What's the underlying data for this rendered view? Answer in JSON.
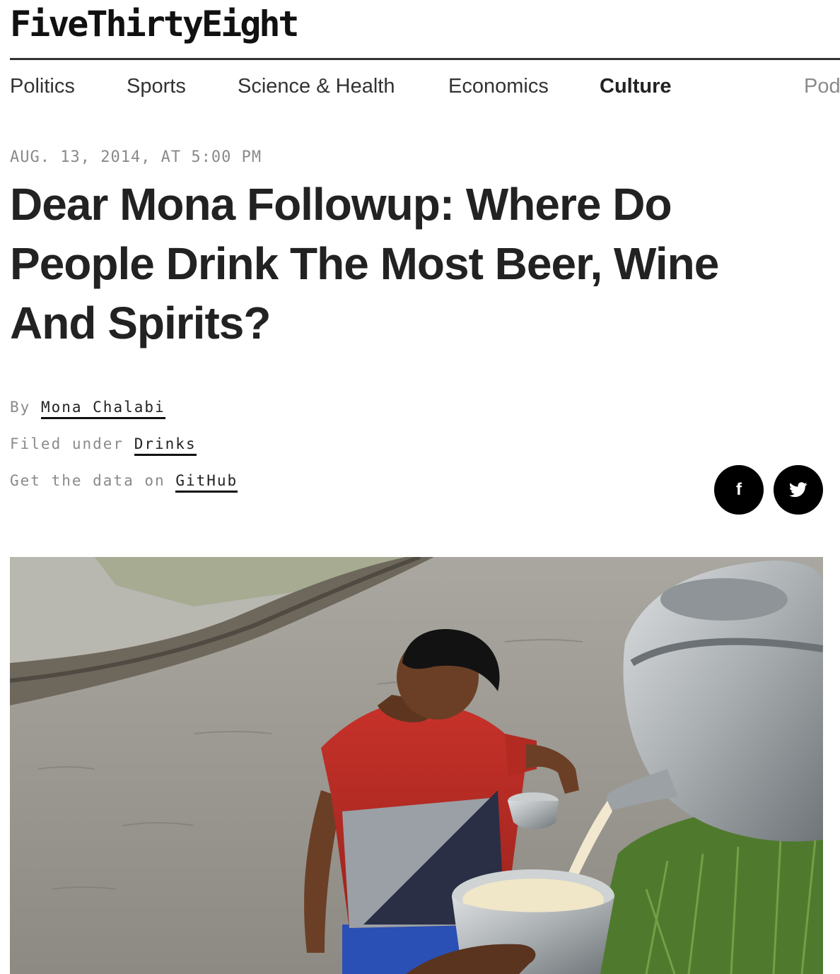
{
  "site": {
    "name": "FiveThirtyEight"
  },
  "nav": {
    "items": [
      {
        "label": "Politics"
      },
      {
        "label": "Sports"
      },
      {
        "label": "Science & Health"
      },
      {
        "label": "Economics"
      },
      {
        "label": "Culture",
        "active": true
      },
      {
        "label": "Pod"
      }
    ]
  },
  "article": {
    "date": "AUG. 13, 2014, AT 5:00 PM",
    "title": "Dear Mona Followup: Where Do People Drink The Most Beer, Wine And Spirits?",
    "byline_prefix": "By",
    "author": "Mona Chalabi",
    "filed_prefix": "Filed under",
    "filed_topic": "Drinks",
    "data_prefix": "Get the data on",
    "data_link": "GitHub"
  },
  "share": {
    "facebook_glyph": "f",
    "facebook_icon": "facebook-icon",
    "twitter_icon": "twitter-icon"
  },
  "photo": {
    "subject": "man in a flooded rice field holding a bowl while a white drink is poured from an aluminium kettle"
  },
  "colors": {
    "text": "#222222",
    "muted": "#8a8a8a",
    "rule": "#333333",
    "icon_bg": "#000000"
  }
}
